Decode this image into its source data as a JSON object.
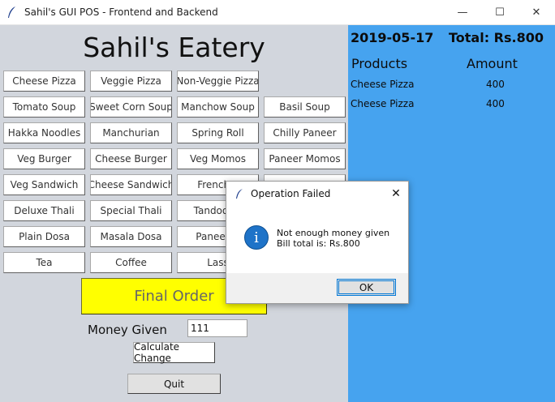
{
  "window": {
    "title": "Sahil's GUI POS - Frontend and Backend",
    "controls": {
      "minimize": "—",
      "maximize": "☐",
      "close": "✕"
    }
  },
  "left": {
    "heading": "Sahil's Eatery",
    "menu": [
      [
        "Cheese Pizza",
        "Veggie Pizza",
        "Non-Veggie Pizza",
        ""
      ],
      [
        "Tomato Soup",
        "Sweet Corn Soup",
        "Manchow Soup",
        "Basil Soup"
      ],
      [
        "Hakka Noodles",
        "Manchurian",
        "Spring Roll",
        "Chilly Paneer"
      ],
      [
        "Veg Burger",
        "Cheese Burger",
        "Veg Momos",
        "Paneer Momos"
      ],
      [
        "Veg Sandwich",
        "Cheese Sandwich",
        "French F",
        ""
      ],
      [
        "Deluxe Thali",
        "Special Thali",
        "Tandoor R",
        ""
      ],
      [
        "Plain Dosa",
        "Masala Dosa",
        "Paneer D",
        ""
      ],
      [
        "Tea",
        "Coffee",
        "Lass",
        ""
      ]
    ],
    "final_order": "Final Order",
    "money_label": "Money Given",
    "money_value": "111",
    "calculate": "Calculate Change",
    "quit": "Quit"
  },
  "right": {
    "date": "2019-05-17",
    "total": "Total: Rs.800",
    "col_products": "Products",
    "col_amount": "Amount",
    "rows": [
      {
        "product": "Cheese Pizza",
        "amount": "400"
      },
      {
        "product": "Cheese Pizza",
        "amount": "400"
      }
    ]
  },
  "dialog": {
    "title": "Operation Failed",
    "close": "✕",
    "icon": "info-icon",
    "line1": "Not enough money given",
    "line2": "Bill total is: Rs.800",
    "ok": "OK"
  },
  "colors": {
    "left_bg": "#d2d6dd",
    "right_bg": "#46a3ef",
    "final_order_bg": "#ffff00",
    "info_icon": "#1e73c8"
  }
}
